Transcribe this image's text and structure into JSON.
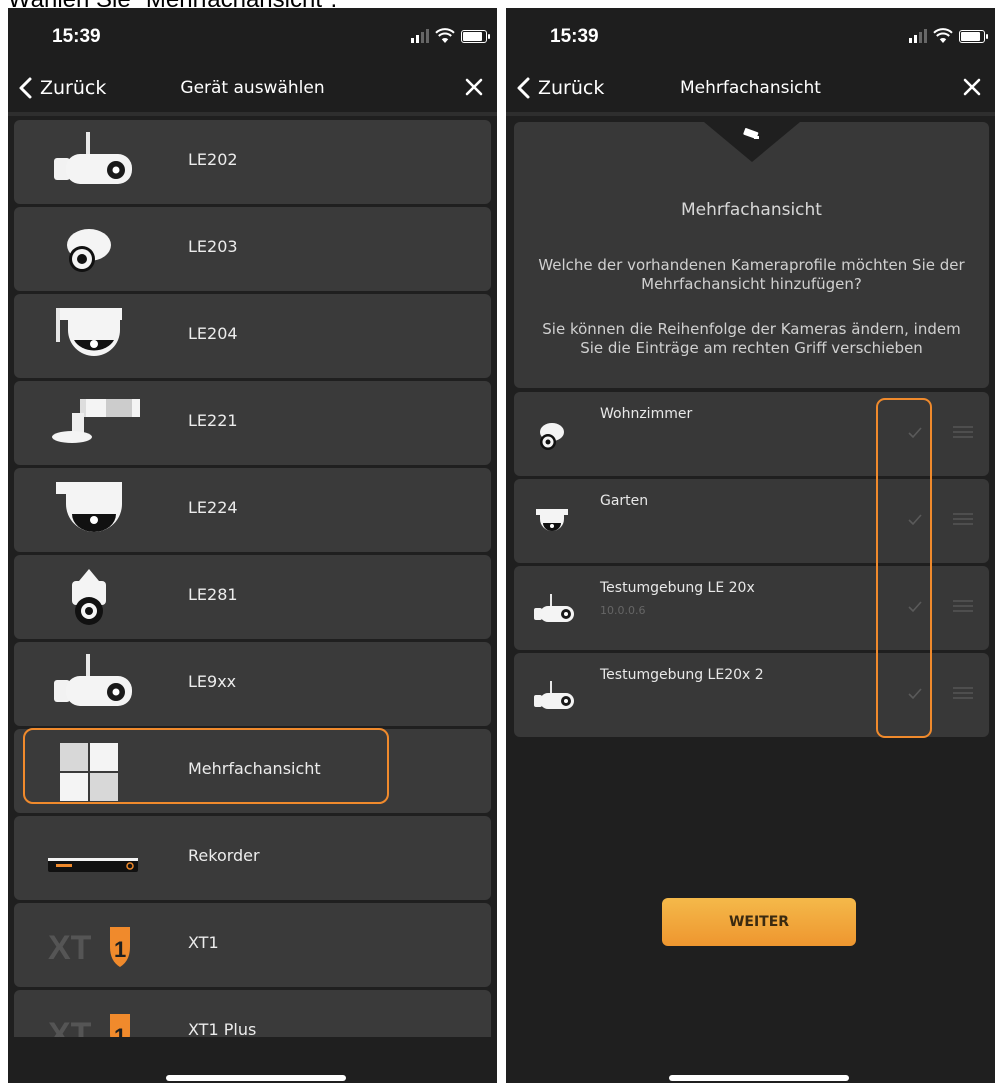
{
  "caption": "Wählen Sie \"Mehrfachansicht\".",
  "colors": {
    "accent": "#f08a2c",
    "background": "#1f1f1f",
    "card": "#3a3a3a",
    "button": "#f0a038"
  },
  "left": {
    "status": {
      "time": "15:39"
    },
    "nav": {
      "back_label": "Zurück",
      "title": "Gerät auswählen"
    },
    "devices": [
      {
        "label": "LE202",
        "icon": "bullet-camera-icon"
      },
      {
        "label": "LE203",
        "icon": "dome-camera-icon"
      },
      {
        "label": "LE204",
        "icon": "ceiling-dome-camera-icon"
      },
      {
        "label": "LE221",
        "icon": "wall-bullet-camera-icon"
      },
      {
        "label": "LE224",
        "icon": "ceiling-dome-camera-icon"
      },
      {
        "label": "LE281",
        "icon": "ptz-camera-icon"
      },
      {
        "label": "LE9xx",
        "icon": "bullet-camera-icon"
      },
      {
        "label": "Mehrfachansicht",
        "icon": "multiview-grid-icon"
      },
      {
        "label": "Rekorder",
        "icon": "recorder-icon"
      },
      {
        "label": "XT1",
        "icon": "xt1-logo-icon"
      },
      {
        "label": "XT1 Plus",
        "icon": "xt1-logo-icon"
      }
    ]
  },
  "right": {
    "status": {
      "time": "15:39"
    },
    "nav": {
      "back_label": "Zurück",
      "title": "Mehrfachansicht"
    },
    "info": {
      "title": "Mehrfachansicht",
      "text1": "Welche der vorhandenen Kameraprofile möchten Sie der Mehrfachansicht hinzufügen?",
      "text2": "Sie können die Reihenfolge der Kameras ändern, indem Sie die Einträge am rechten Griff verschieben"
    },
    "cameras": [
      {
        "name": "Wohnzimmer",
        "sub": "",
        "icon": "dome-camera-icon"
      },
      {
        "name": "Garten",
        "sub": "",
        "icon": "ceiling-dome-camera-icon"
      },
      {
        "name": "Testumgebung LE 20x",
        "sub": "10.0.0.6",
        "icon": "bullet-camera-icon"
      },
      {
        "name": "Testumgebung LE20x 2",
        "sub": "",
        "icon": "bullet-camera-icon"
      }
    ],
    "button_label": "WEITER"
  }
}
